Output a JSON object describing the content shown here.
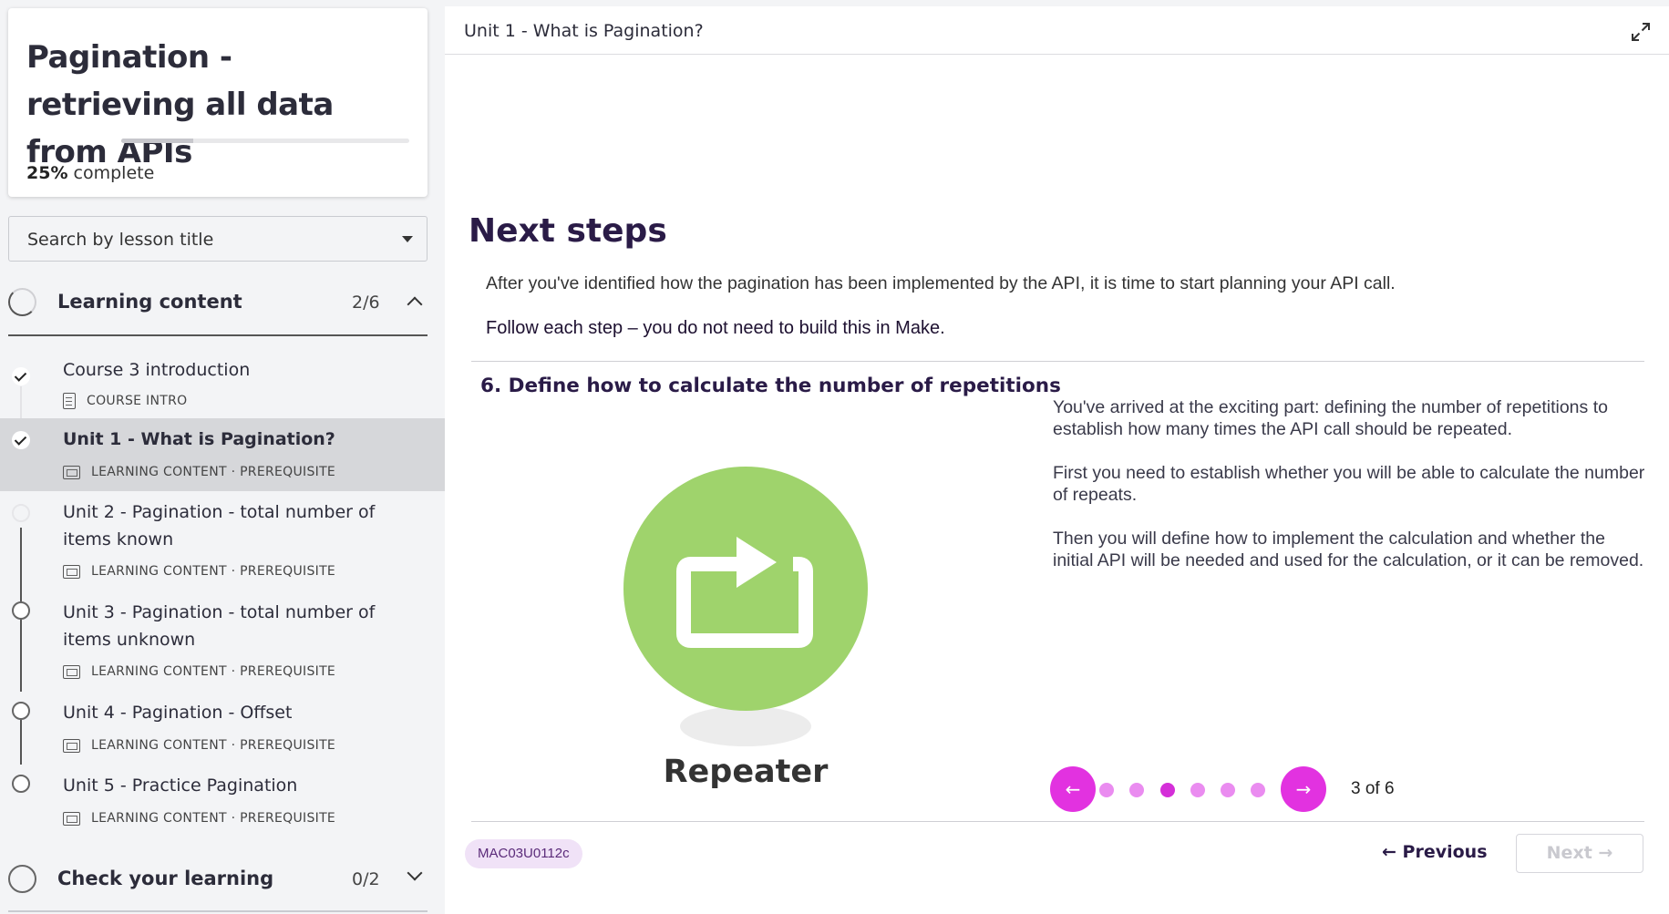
{
  "course": {
    "title": "Pagination - retrieving all data from APIs",
    "progress_percent": "25%",
    "progress_fraction": 0.25,
    "progress_suffix": "complete"
  },
  "search": {
    "placeholder": "Search by lesson title"
  },
  "sections": [
    {
      "title": "Learning content",
      "count": "2/6",
      "expanded": true
    },
    {
      "title": "Check your learning",
      "count": "0/2",
      "expanded": false
    }
  ],
  "lessons": [
    {
      "title": "Course 3 introduction",
      "meta": "COURSE INTRO",
      "status": "done",
      "icon": "document-icon"
    },
    {
      "title": "Unit 1 - What is Pagination?",
      "meta": "LEARNING CONTENT · PREREQUISITE",
      "status": "done",
      "active": true,
      "icon": "slides-icon"
    },
    {
      "title": "Unit 2 - Pagination - total number of items known",
      "meta": "LEARNING CONTENT · PREREQUISITE",
      "status": "current",
      "icon": "slides-icon"
    },
    {
      "title": "Unit 3 - Pagination - total number of items unknown",
      "meta": "LEARNING CONTENT · PREREQUISITE",
      "status": "todo",
      "icon": "slides-icon"
    },
    {
      "title": "Unit 4 - Pagination - Offset",
      "meta": "LEARNING CONTENT · PREREQUISITE",
      "status": "todo",
      "icon": "slides-icon"
    },
    {
      "title": "Unit 5 - Practice Pagination",
      "meta": "LEARNING CONTENT · PREREQUISITE",
      "status": "todo",
      "icon": "slides-icon"
    }
  ],
  "main": {
    "unit_title": "Unit 1 - What is Pagination?",
    "heading": "Next steps",
    "intro": "After you've identified how the pagination has been implemented by the API, it is time to start planning your API call.",
    "follow": "Follow each step – you do not need to build this in Make.",
    "step_title": "6. Define how to calculate the number of repetitions",
    "image_label": "Repeater",
    "paragraphs": [
      "You've arrived at the exciting part: defining the number of repetitions to establish how many times the API call should be repeated.",
      "First you need to establish whether you will be able to calculate the number of repeats.",
      "Then you will define how to implement the calculation and whether the initial API will be needed and used for the calculation, or it can be removed."
    ],
    "pager": {
      "current": 3,
      "total": 6,
      "label": "3 of 6",
      "prev_icon": "←",
      "next_icon": "→"
    },
    "code": "MAC03U0112c",
    "previous_label": "← Previous",
    "next_label": "Next →"
  },
  "colors": {
    "accent": "#e232e0",
    "heading": "#2a1b47",
    "repeater_green": "#9fd36c"
  }
}
